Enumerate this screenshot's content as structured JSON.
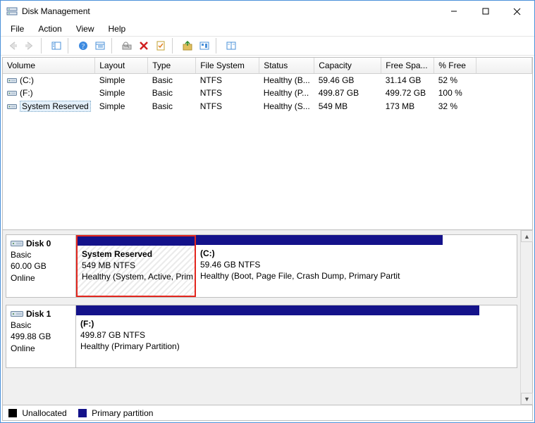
{
  "window": {
    "title": "Disk Management"
  },
  "menu": {
    "file": "File",
    "action": "Action",
    "view": "View",
    "help": "Help"
  },
  "columns": {
    "volume": "Volume",
    "layout": "Layout",
    "type": "Type",
    "filesystem": "File System",
    "status": "Status",
    "capacity": "Capacity",
    "freespace": "Free Spa...",
    "pctfree": "% Free"
  },
  "volumes": [
    {
      "name": "(C:)",
      "layout": "Simple",
      "type": "Basic",
      "fs": "NTFS",
      "status": "Healthy (B...",
      "capacity": "59.46 GB",
      "free": "31.14 GB",
      "pct": "52 %"
    },
    {
      "name": "(F:)",
      "layout": "Simple",
      "type": "Basic",
      "fs": "NTFS",
      "status": "Healthy (P...",
      "capacity": "499.87 GB",
      "free": "499.72 GB",
      "pct": "100 %"
    },
    {
      "name": "System Reserved",
      "layout": "Simple",
      "type": "Basic",
      "fs": "NTFS",
      "status": "Healthy (S...",
      "capacity": "549 MB",
      "free": "173 MB",
      "pct": "32 %",
      "selected": true
    }
  ],
  "disks": [
    {
      "name": "Disk 0",
      "type": "Basic",
      "size": "60.00 GB",
      "state": "Online",
      "parts": [
        {
          "label": "System Reserved",
          "sub": "549 MB NTFS",
          "status": "Healthy (System, Active, Prim",
          "selected": true,
          "hatched": true,
          "widthpx": 170
        },
        {
          "label": "(C:)",
          "sub": "59.46 GB NTFS",
          "status": "Healthy (Boot, Page File, Crash Dump, Primary Partit",
          "widthpx": 350
        }
      ]
    },
    {
      "name": "Disk 1",
      "type": "Basic",
      "size": "499.88 GB",
      "state": "Online",
      "parts": [
        {
          "label": "(F:)",
          "sub": "499.87 GB NTFS",
          "status": "Healthy (Primary Partition)",
          "widthpx": 572
        }
      ]
    }
  ],
  "legend": {
    "unallocated": "Unallocated",
    "primary": "Primary partition"
  }
}
